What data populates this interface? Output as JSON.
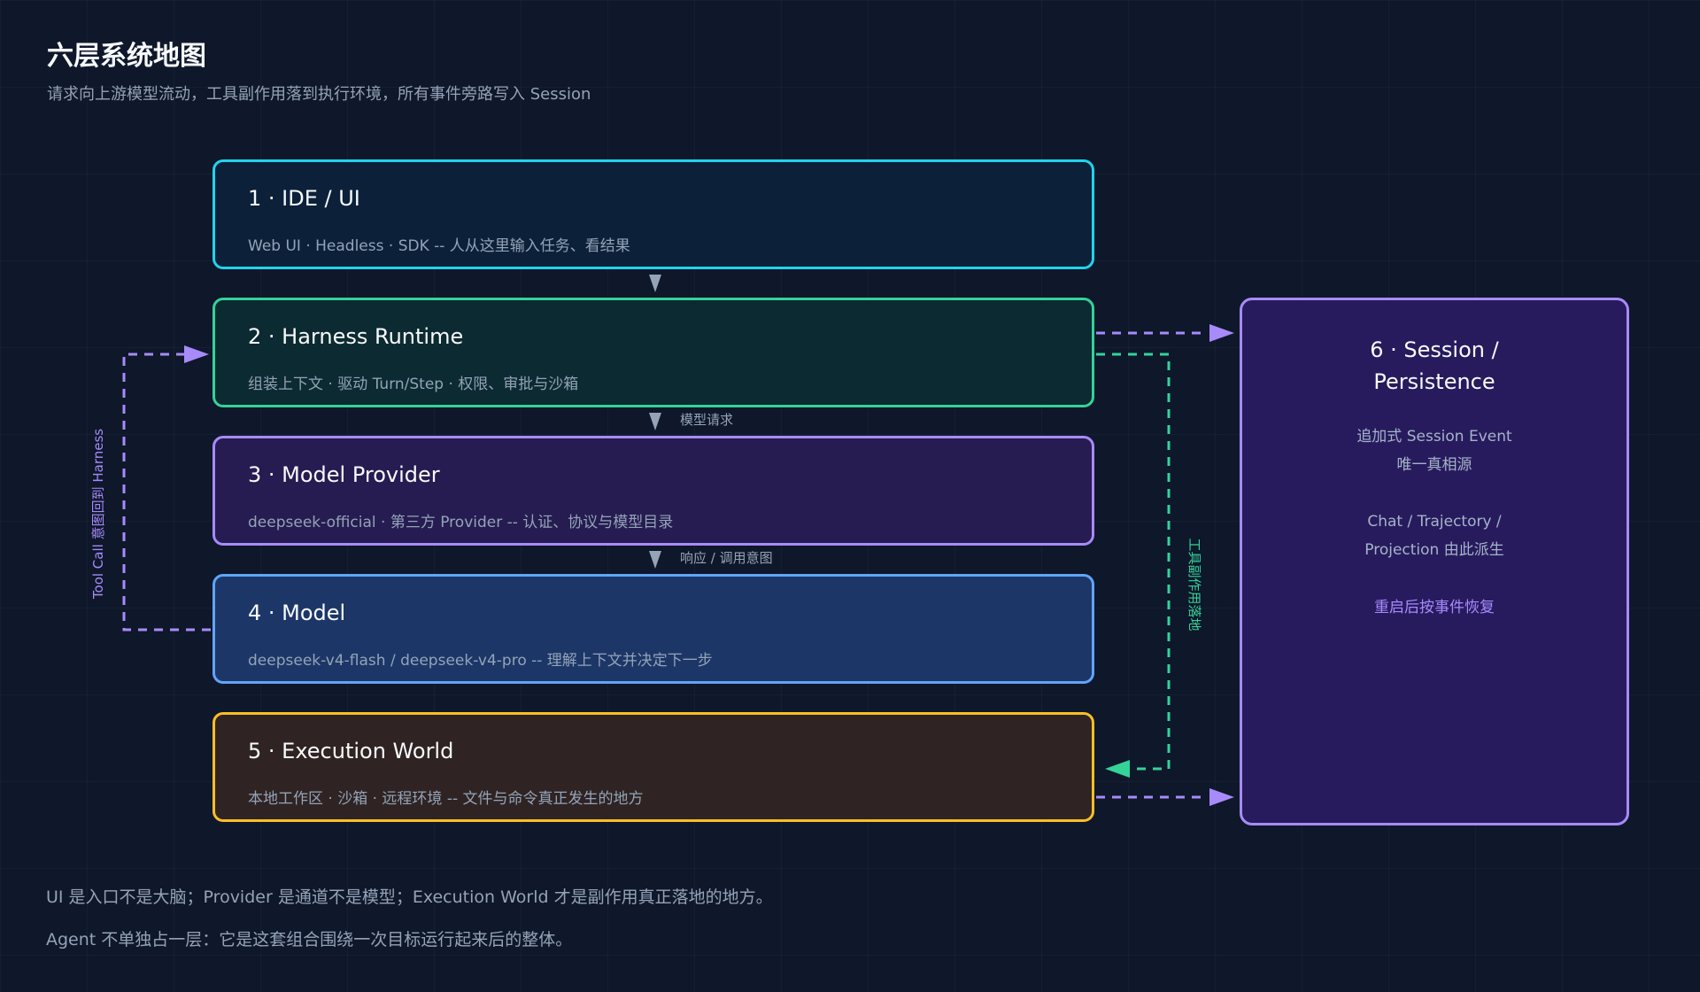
{
  "header": {
    "title": "六层系统地图",
    "subtitle": "请求向上游模型流动，工具副作用落到执行环境，所有事件旁路写入 Session"
  },
  "layers": [
    {
      "name": "1 · IDE / UI",
      "desc": "Web UI · Headless · SDK -- 人从这里输入任务、看结果",
      "border": "#22d3ee"
    },
    {
      "name": "2 · Harness Runtime",
      "desc": "组装上下文 · 驱动 Turn/Step · 权限、审批与沙箱",
      "border": "#34d399"
    },
    {
      "name": "3 · Model Provider",
      "desc": "deepseek-official · 第三方 Provider -- 认证、协议与模型目录",
      "border": "#a78bfa"
    },
    {
      "name": "4 · Model",
      "desc": "deepseek-v4-flash / deepseek-v4-pro -- 理解上下文并决定下一步",
      "border": "#60a5fa"
    },
    {
      "name": "5 · Execution World",
      "desc": "本地工作区 · 沙箱 · 远程环境 -- 文件与命令真正发生的地方",
      "border": "#fbbf24"
    }
  ],
  "session": {
    "title": "6 · Session /\nPersistence",
    "note1": "追加式 Session Event\n唯一真相源",
    "note2": "Chat / Trajectory /\nProjection 由此派生",
    "note3": "重启后按事件恢复",
    "border": "#a78bfa"
  },
  "edges": {
    "model_request": "模型请求",
    "response_intent": "响应 / 调用意图",
    "tool_call_back": "Tool Call 意图回到 Harness",
    "tool_side_effect": "工具副作用落地"
  },
  "colors": {
    "request_arrow": "#94a3b8",
    "tool_call_loop": "#a78bfa",
    "side_effect": "#34d399",
    "session_write": "#a78bfa"
  },
  "footer": {
    "line1": "UI 是入口不是大脑；Provider 是通道不是模型；Execution World 才是副作用真正落地的地方。",
    "line2": "Agent 不单独占一层：它是这套组合围绕一次目标运行起来后的整体。"
  }
}
